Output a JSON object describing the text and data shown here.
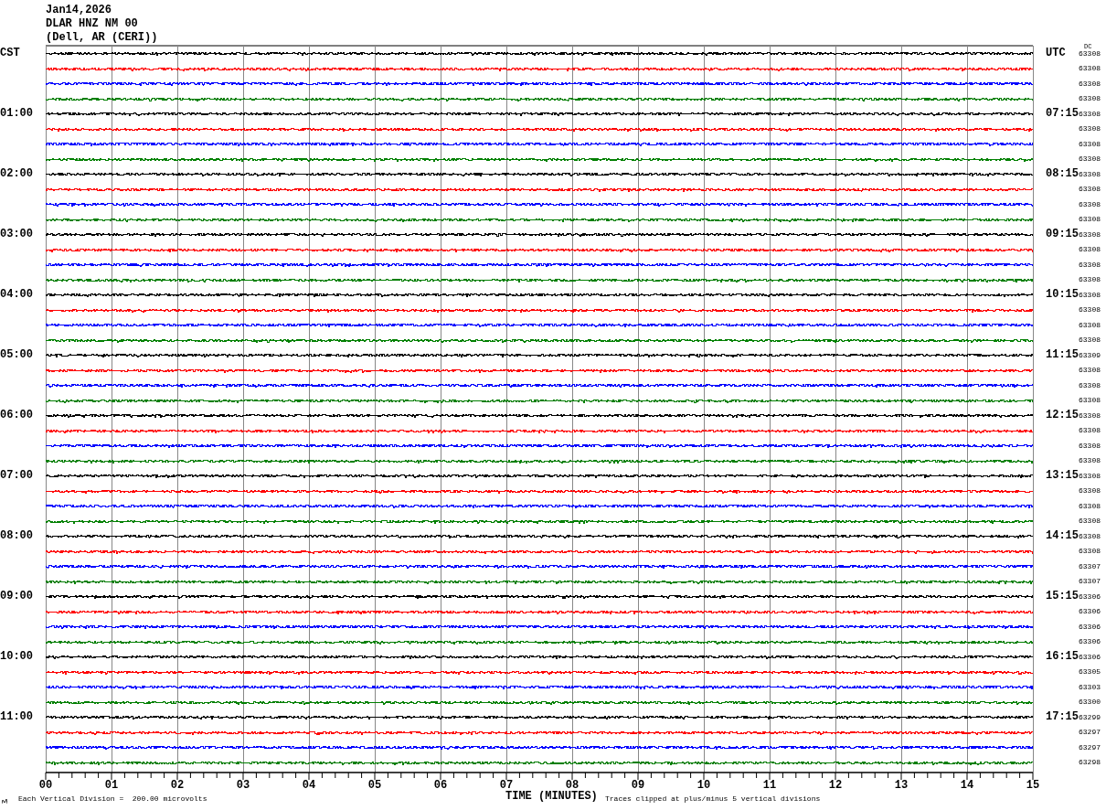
{
  "header": [
    "Jan14,2026",
    "DLAR HNZ NM 00",
    "(Dell, AR (CERI))"
  ],
  "left_heading": "CST",
  "right_heading": "UTC",
  "dc_heading": "DC",
  "traces": [
    {
      "color": "#000000",
      "dc": "63308"
    },
    {
      "color": "#ff0000",
      "dc": "63308"
    },
    {
      "color": "#0000ff",
      "dc": "63308"
    },
    {
      "color": "#007f00",
      "dc": "63308"
    },
    {
      "color": "#000000",
      "dc": "63308",
      "cst": "01:00",
      "utc": "07:15"
    },
    {
      "color": "#ff0000",
      "dc": "63308"
    },
    {
      "color": "#0000ff",
      "dc": "63308"
    },
    {
      "color": "#007f00",
      "dc": "63308"
    },
    {
      "color": "#000000",
      "dc": "63308",
      "cst": "02:00",
      "utc": "08:15"
    },
    {
      "color": "#ff0000",
      "dc": "63308"
    },
    {
      "color": "#0000ff",
      "dc": "63308"
    },
    {
      "color": "#007f00",
      "dc": "63308"
    },
    {
      "color": "#000000",
      "dc": "63308",
      "cst": "03:00",
      "utc": "09:15"
    },
    {
      "color": "#ff0000",
      "dc": "63308"
    },
    {
      "color": "#0000ff",
      "dc": "63308"
    },
    {
      "color": "#007f00",
      "dc": "63308"
    },
    {
      "color": "#000000",
      "dc": "63308",
      "cst": "04:00",
      "utc": "10:15"
    },
    {
      "color": "#ff0000",
      "dc": "63308"
    },
    {
      "color": "#0000ff",
      "dc": "63308"
    },
    {
      "color": "#007f00",
      "dc": "63308"
    },
    {
      "color": "#000000",
      "dc": "63309",
      "cst": "05:00",
      "utc": "11:15"
    },
    {
      "color": "#ff0000",
      "dc": "63308"
    },
    {
      "color": "#0000ff",
      "dc": "63308"
    },
    {
      "color": "#007f00",
      "dc": "63308"
    },
    {
      "color": "#000000",
      "dc": "63308",
      "cst": "06:00",
      "utc": "12:15"
    },
    {
      "color": "#ff0000",
      "dc": "63308"
    },
    {
      "color": "#0000ff",
      "dc": "63308"
    },
    {
      "color": "#007f00",
      "dc": "63308"
    },
    {
      "color": "#000000",
      "dc": "63308",
      "cst": "07:00",
      "utc": "13:15"
    },
    {
      "color": "#ff0000",
      "dc": "63308"
    },
    {
      "color": "#0000ff",
      "dc": "63308"
    },
    {
      "color": "#007f00",
      "dc": "63308"
    },
    {
      "color": "#000000",
      "dc": "63308",
      "cst": "08:00",
      "utc": "14:15"
    },
    {
      "color": "#ff0000",
      "dc": "63308"
    },
    {
      "color": "#0000ff",
      "dc": "63307"
    },
    {
      "color": "#007f00",
      "dc": "63307"
    },
    {
      "color": "#000000",
      "dc": "63306",
      "cst": "09:00",
      "utc": "15:15"
    },
    {
      "color": "#ff0000",
      "dc": "63306"
    },
    {
      "color": "#0000ff",
      "dc": "63306"
    },
    {
      "color": "#007f00",
      "dc": "63306"
    },
    {
      "color": "#000000",
      "dc": "63306",
      "cst": "10:00",
      "utc": "16:15"
    },
    {
      "color": "#ff0000",
      "dc": "63305"
    },
    {
      "color": "#0000ff",
      "dc": "63303"
    },
    {
      "color": "#007f00",
      "dc": "63300"
    },
    {
      "color": "#000000",
      "dc": "63299",
      "cst": "11:00",
      "utc": "17:15"
    },
    {
      "color": "#ff0000",
      "dc": "63297"
    },
    {
      "color": "#0000ff",
      "dc": "63297"
    },
    {
      "color": "#007f00",
      "dc": "63298"
    }
  ],
  "xticks": [
    "00",
    "01",
    "02",
    "03",
    "04",
    "05",
    "06",
    "07",
    "08",
    "09",
    "10",
    "11",
    "12",
    "13",
    "14",
    "15"
  ],
  "xlabel": "TIME (MINUTES)",
  "scale_note": "Each Vertical Division =  200.00 microvolts",
  "clip_note": "Traces clipped at plus/minus 5 vertical divisions"
}
